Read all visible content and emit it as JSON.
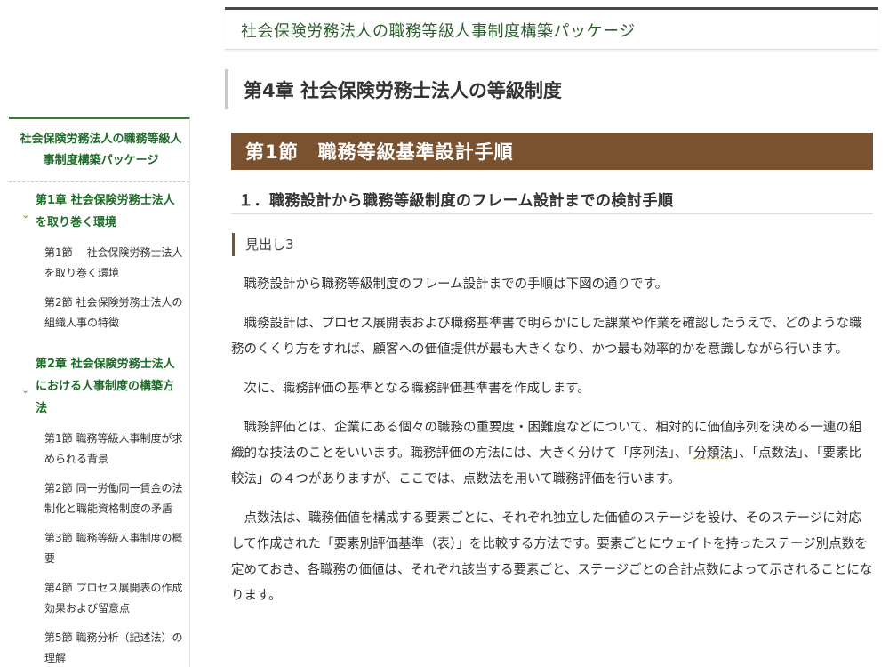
{
  "sidebar": {
    "top_title": "社会保険労務法人の職務等級人事制度構築パッケージ",
    "chapter1": {
      "title": "第1章 社会保険労務士法人を取り巻く環境",
      "sections": [
        "第1節　 社会保険労務士法人を取り巻く環境",
        "第2節 社会保険労務士法人の組織人事の特徴"
      ]
    },
    "chapter2": {
      "title": "第2章 社会保険労務士法人における人事制度の構築方法",
      "sections": [
        "第1節 職務等級人事制度が求められる背景",
        "第2節 同一労働同一賃金の法制化と職能資格制度の矛盾",
        "第3節 職務等級人事制度の概要",
        "第4節 プロセス展開表の作成効果および留意点",
        "第5節 職務分析（記述法）の理解"
      ]
    },
    "chevron_glyph": "⌄"
  },
  "main": {
    "package_title": "社会保険労務法人の職務等級人事制度構築パッケージ",
    "chapter_heading": "第4章 社会保険労務士法人の等級制度",
    "section_heading": "第1節　職務等級基準設計手順",
    "subsection_heading": "１．職務設計から職務等級制度のフレーム設計までの検討手順",
    "h3": "見出し3",
    "paragraphs": {
      "p1": "職務設計から職務等級制度のフレーム設計までの手順は下図の通りです。",
      "p2": "職務設計は、プロセス展開表および職務基準書で明らかにした課業や作業を確認したうえで、どのような職務のくくり方をすれば、顧客への価値提供が最も大きくなり、かつ最も効率的かを意識しながら行います。",
      "p3": "次に、職務評価の基準となる職務評価基準書を作成します。",
      "p4_a": "職務評価とは、企業にある個々の職務の重要度・困難度などについて、相対的に価値序列を決める一連の組織的な技法のことをいいます。職務評価の方法には、大きく分けて「序列法」、「",
      "p4_b": "分類法",
      "p4_c": "」、「点数法」、「要素比較法」の４つがありますが、ここでは、点数法を用いて職務評価を行います。",
      "p5": "点数法は、職務価値を構成する要素ごとに、それぞれ独立した価値のステージを設け、そのステージに対応して作成された「要素別評価基準（表）」を比較する方法です。要素ごとにウェイトを持ったステージ別点数を定めておき、各職務の価値は、それぞれ該当する要素ごと、ステージごとの合計点数によって示されることになります。"
    }
  },
  "colors": {
    "green_accent": "#2e7d32",
    "section_band": "#7b5230",
    "text": "#333333"
  }
}
